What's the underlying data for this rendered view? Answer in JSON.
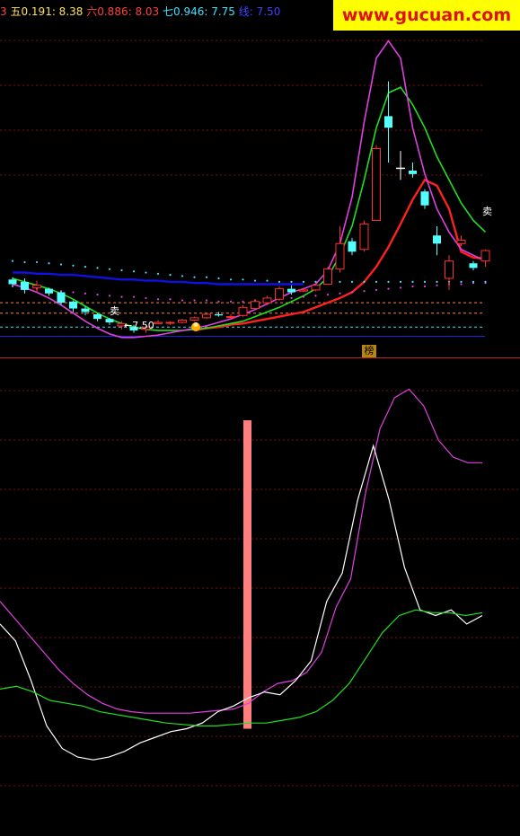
{
  "header": {
    "items": [
      {
        "label": "3",
        "color": "#ff4040"
      },
      {
        "label": "五0.191: 8.38",
        "color": "#ffe060"
      },
      {
        "label": "六0.886: 8.03",
        "color": "#ff4040"
      },
      {
        "label": "七0.946: 7.75",
        "color": "#40e0ff"
      },
      {
        "label": "线: 7.50",
        "color": "#4040ff"
      }
    ]
  },
  "watermark": {
    "text": "www.gucuan.com",
    "bg": "#ffff00",
    "color": "#e01010"
  },
  "annotations": {
    "low_marker": "←7.50",
    "sell_left": "卖",
    "sell_right": "卖",
    "bang": "榜"
  },
  "chart_data": [
    {
      "type": "candlestick",
      "panel": "upper",
      "candles": [
        {
          "o": 8.04,
          "h": 8.06,
          "l": 7.98,
          "c": 8.0,
          "dir": "down"
        },
        {
          "o": 8.02,
          "h": 8.05,
          "l": 7.92,
          "c": 7.95,
          "dir": "down"
        },
        {
          "o": 7.97,
          "h": 8.03,
          "l": 7.93,
          "c": 7.99,
          "dir": "up"
        },
        {
          "o": 7.96,
          "h": 7.97,
          "l": 7.9,
          "c": 7.92,
          "dir": "down"
        },
        {
          "o": 7.93,
          "h": 7.94,
          "l": 7.82,
          "c": 7.84,
          "dir": "down"
        },
        {
          "o": 7.85,
          "h": 7.86,
          "l": 7.76,
          "c": 7.79,
          "dir": "down"
        },
        {
          "o": 7.79,
          "h": 7.81,
          "l": 7.73,
          "c": 7.76,
          "dir": "down"
        },
        {
          "o": 7.74,
          "h": 7.75,
          "l": 7.68,
          "c": 7.7,
          "dir": "down"
        },
        {
          "o": 7.7,
          "h": 7.71,
          "l": 7.65,
          "c": 7.67,
          "dir": "down"
        },
        {
          "o": 7.64,
          "h": 7.68,
          "l": 7.61,
          "c": 7.66,
          "dir": "up"
        },
        {
          "o": 7.63,
          "h": 7.65,
          "l": 7.58,
          "c": 7.6,
          "dir": "down"
        },
        {
          "o": 7.61,
          "h": 7.64,
          "l": 7.58,
          "c": 7.63,
          "dir": "up"
        },
        {
          "o": 7.66,
          "h": 7.69,
          "l": 7.66,
          "c": 7.67,
          "dir": "up"
        },
        {
          "o": 7.67,
          "h": 7.68,
          "l": 7.65,
          "c": 7.67,
          "dir": "up"
        },
        {
          "o": 7.67,
          "h": 7.7,
          "l": 7.66,
          "c": 7.69,
          "dir": "up"
        },
        {
          "o": 7.69,
          "h": 7.72,
          "l": 7.68,
          "c": 7.71,
          "dir": "up"
        },
        {
          "o": 7.71,
          "h": 7.75,
          "l": 7.7,
          "c": 7.74,
          "dir": "up"
        },
        {
          "o": 7.74,
          "h": 7.76,
          "l": 7.72,
          "c": 7.73,
          "dir": "down"
        },
        {
          "o": 7.72,
          "h": 7.74,
          "l": 7.7,
          "c": 7.72,
          "dir": "up"
        },
        {
          "o": 7.73,
          "h": 7.82,
          "l": 7.72,
          "c": 7.8,
          "dir": "up"
        },
        {
          "o": 7.79,
          "h": 7.87,
          "l": 7.78,
          "c": 7.85,
          "dir": "up"
        },
        {
          "o": 7.84,
          "h": 7.9,
          "l": 7.82,
          "c": 7.88,
          "dir": "up"
        },
        {
          "o": 7.87,
          "h": 7.98,
          "l": 7.86,
          "c": 7.96,
          "dir": "up"
        },
        {
          "o": 7.96,
          "h": 7.99,
          "l": 7.91,
          "c": 7.93,
          "dir": "down"
        },
        {
          "o": 7.94,
          "h": 7.97,
          "l": 7.93,
          "c": 7.95,
          "dir": "up"
        },
        {
          "o": 7.95,
          "h": 8.0,
          "l": 7.94,
          "c": 7.99,
          "dir": "up"
        },
        {
          "o": 8.0,
          "h": 8.15,
          "l": 8.0,
          "c": 8.13,
          "dir": "up"
        },
        {
          "o": 8.13,
          "h": 8.5,
          "l": 8.1,
          "c": 8.35,
          "dir": "up"
        },
        {
          "o": 8.37,
          "h": 8.4,
          "l": 8.25,
          "c": 8.28,
          "dir": "down"
        },
        {
          "o": 8.3,
          "h": 8.55,
          "l": 8.28,
          "c": 8.52,
          "dir": "up"
        },
        {
          "o": 8.55,
          "h": 9.2,
          "l": 8.55,
          "c": 9.17,
          "dir": "up"
        },
        {
          "o": 9.35,
          "h": 9.75,
          "l": 9.05,
          "c": 9.45,
          "dir": "down"
        },
        {
          "o": 9.0,
          "h": 9.15,
          "l": 8.9,
          "c": 9.0,
          "dir": "flat"
        },
        {
          "o": 8.98,
          "h": 9.05,
          "l": 8.92,
          "c": 8.95,
          "dir": "down"
        },
        {
          "o": 8.8,
          "h": 8.82,
          "l": 8.65,
          "c": 8.68,
          "dir": "down"
        },
        {
          "o": 8.35,
          "h": 8.5,
          "l": 8.25,
          "c": 8.42,
          "dir": "down"
        },
        {
          "o": 8.05,
          "h": 8.25,
          "l": 7.95,
          "c": 8.2,
          "dir": "up"
        },
        {
          "o": 8.35,
          "h": 8.42,
          "l": 8.33,
          "c": 8.38,
          "dir": "up"
        },
        {
          "o": 8.18,
          "h": 8.2,
          "l": 8.12,
          "c": 8.14,
          "dir": "down"
        },
        {
          "o": 8.2,
          "h": 8.3,
          "l": 8.15,
          "c": 8.29,
          "dir": "up"
        }
      ],
      "lines": [
        {
          "color": "#ff2020",
          "values": [
            null,
            null,
            null,
            null,
            null,
            null,
            null,
            null,
            null,
            null,
            null,
            null,
            null,
            null,
            null,
            7.6,
            7.62,
            7.63,
            7.65,
            7.66,
            7.68,
            7.7,
            7.72,
            7.74,
            7.76,
            7.8,
            7.84,
            7.88,
            7.93,
            8.02,
            8.15,
            8.32,
            8.52,
            8.73,
            8.9,
            8.85,
            8.65,
            8.28,
            8.23,
            8.22
          ]
        },
        {
          "color": "#20e020",
          "values": [
            8.05,
            8.02,
            7.99,
            7.96,
            7.92,
            7.87,
            7.81,
            7.75,
            7.7,
            7.66,
            7.63,
            7.61,
            7.6,
            7.6,
            7.6,
            7.61,
            7.62,
            7.64,
            7.66,
            7.68,
            7.72,
            7.76,
            7.8,
            7.85,
            7.9,
            7.96,
            8.06,
            8.25,
            8.5,
            8.9,
            9.35,
            9.65,
            9.7,
            9.55,
            9.35,
            9.1,
            8.9,
            8.7,
            8.55,
            8.45
          ]
        },
        {
          "color": "#e040e0",
          "values": [
            8.0,
            7.97,
            7.93,
            7.88,
            7.82,
            7.75,
            7.68,
            7.62,
            7.57,
            7.54,
            7.54,
            7.55,
            7.56,
            7.58,
            7.6,
            7.62,
            7.64,
            7.67,
            7.7,
            7.74,
            7.78,
            7.83,
            7.88,
            7.93,
            7.96,
            8.0,
            8.12,
            8.35,
            8.75,
            9.4,
            9.95,
            10.1,
            9.95,
            9.35,
            8.95,
            8.65,
            8.45,
            8.3,
            8.25,
            8.2
          ]
        },
        {
          "color": "#1010e0",
          "values": [
            8.1,
            8.1,
            8.09,
            8.09,
            8.08,
            8.08,
            8.07,
            8.06,
            8.05,
            8.04,
            8.04,
            8.03,
            8.03,
            8.02,
            8.02,
            8.01,
            8.01,
            8.0,
            8.0,
            8.0,
            8.0,
            8.0,
            8.0,
            8.0,
            8.0,
            null,
            null,
            null,
            null,
            null,
            null,
            null,
            null,
            null,
            null,
            null,
            null,
            null,
            null,
            null
          ]
        },
        {
          "color": "#e040e0",
          "style": "dotted",
          "values": [
            7.98,
            7.97,
            7.96,
            7.95,
            7.94,
            7.93,
            7.92,
            7.91,
            7.9,
            7.89,
            7.89,
            7.88,
            7.87,
            7.87,
            7.86,
            7.86,
            7.86,
            7.85,
            7.85,
            7.85,
            7.86,
            7.86,
            7.87,
            7.88,
            7.89,
            7.9,
            7.91,
            7.92,
            7.93,
            7.94,
            7.95,
            7.96,
            7.97,
            7.98,
            7.98,
            7.99,
            8.0,
            8.0,
            8.01,
            8.01
          ]
        },
        {
          "color": "#40e0ff",
          "style": "dotted",
          "values": [
            8.2,
            8.19,
            8.19,
            8.18,
            8.17,
            8.16,
            8.15,
            8.14,
            8.13,
            8.12,
            8.11,
            8.1,
            8.09,
            8.08,
            8.07,
            8.06,
            8.06,
            8.05,
            8.04,
            8.04,
            8.03,
            8.03,
            8.02,
            8.02,
            8.02,
            8.02,
            8.02,
            8.02,
            8.02,
            8.02,
            8.02,
            8.02,
            8.02,
            8.02,
            8.02,
            8.02,
            8.02,
            8.02,
            8.02,
            8.02
          ]
        }
      ],
      "hlines": [
        {
          "value": 7.84,
          "color": "#ff8040",
          "style": "dashed"
        },
        {
          "value": 7.75,
          "color": "#ff8040",
          "style": "dashed"
        },
        {
          "value": 7.63,
          "color": "#40e0ff",
          "style": "dashed"
        },
        {
          "value": 7.55,
          "color": "#2020e0",
          "style": "solid"
        }
      ],
      "ylim": [
        7.43,
        10.22
      ]
    },
    {
      "type": "line",
      "panel": "lower",
      "series": [
        {
          "color": "#e040e0",
          "values": [
            76,
            70,
            64,
            58,
            52,
            47,
            43,
            40,
            38,
            37,
            36.5,
            36.5,
            36.5,
            36.5,
            37,
            37.5,
            38,
            40,
            44,
            47,
            48,
            51,
            58,
            74,
            84,
            114,
            137,
            148,
            151,
            145,
            133,
            127,
            125,
            125
          ]
        },
        {
          "color": "#ffffff",
          "values": [
            68,
            62,
            48,
            32,
            24,
            21,
            20,
            21,
            23,
            26,
            28,
            30,
            31,
            33,
            37,
            39,
            42,
            44,
            43,
            48,
            55,
            76,
            86,
            112,
            131,
            112,
            88,
            73,
            71,
            73,
            68,
            71
          ]
        },
        {
          "color": "#20e020",
          "values": [
            45,
            46,
            44,
            41,
            40,
            39,
            37,
            36,
            35,
            34,
            33,
            32.5,
            32,
            32,
            32.5,
            33,
            33,
            34,
            35,
            37,
            41,
            47,
            56,
            65,
            71,
            73,
            72,
            72,
            71,
            72
          ]
        }
      ],
      "bar": {
        "index": 15,
        "from": 31,
        "to": 140,
        "color": "#ff7f7f"
      },
      "ylim": [
        -5,
        160
      ]
    }
  ]
}
